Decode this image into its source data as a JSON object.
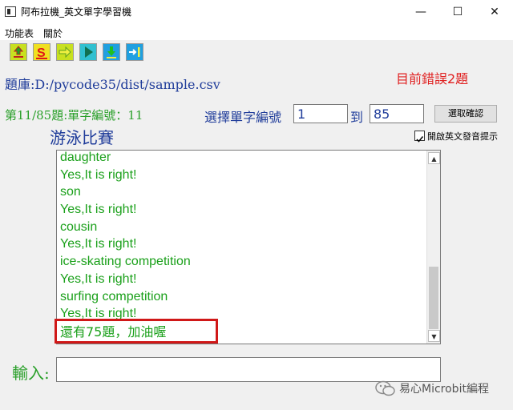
{
  "window": {
    "title": "阿布拉機_英文單字學習機",
    "minimize": "—",
    "maximize": "☐",
    "close": "✕"
  },
  "menu": [
    "功能表",
    "關於"
  ],
  "toolbar": {
    "buttons": [
      {
        "icon": "upload-icon",
        "color": "#c8e020"
      },
      {
        "icon": "s-letter-icon",
        "color": "#f0e020"
      },
      {
        "icon": "arrow-right-icon",
        "color": "#c8e020"
      },
      {
        "icon": "play-icon",
        "color": "#20b0c8"
      },
      {
        "icon": "download-icon",
        "color": "#20a0e0"
      },
      {
        "icon": "skip-to-end-icon",
        "color": "#20a0e0"
      }
    ]
  },
  "question_bank": "題庫:D:/pycode35/dist/sample.csv",
  "error_count_text": "目前錯誤2題",
  "progress_text": "第11/85題:單字編號：11",
  "select_range": {
    "label": "選擇單字編號",
    "from": "1",
    "to_label": "到",
    "to": "85",
    "confirm": "選取確認"
  },
  "pronunciation_hint": {
    "checked": true,
    "label": "開啟英文發音提示"
  },
  "current_word": "游泳比賽",
  "log_lines": [
    "daughter",
    "Yes,It is right!",
    "son",
    "Yes,It is right!",
    "cousin",
    "Yes,It is right!",
    "ice-skating competition",
    "Yes,It is right!",
    "surfing competition",
    "Yes,It is right!"
  ],
  "remaining_text": "還有75題，加油喔",
  "input": {
    "label": "輸入:",
    "value": ""
  },
  "watermark": "易心Microbit編程",
  "colors": {
    "accent_blue": "#1f3c9a",
    "green_text": "#1aa01a",
    "error_red": "#e02020"
  }
}
